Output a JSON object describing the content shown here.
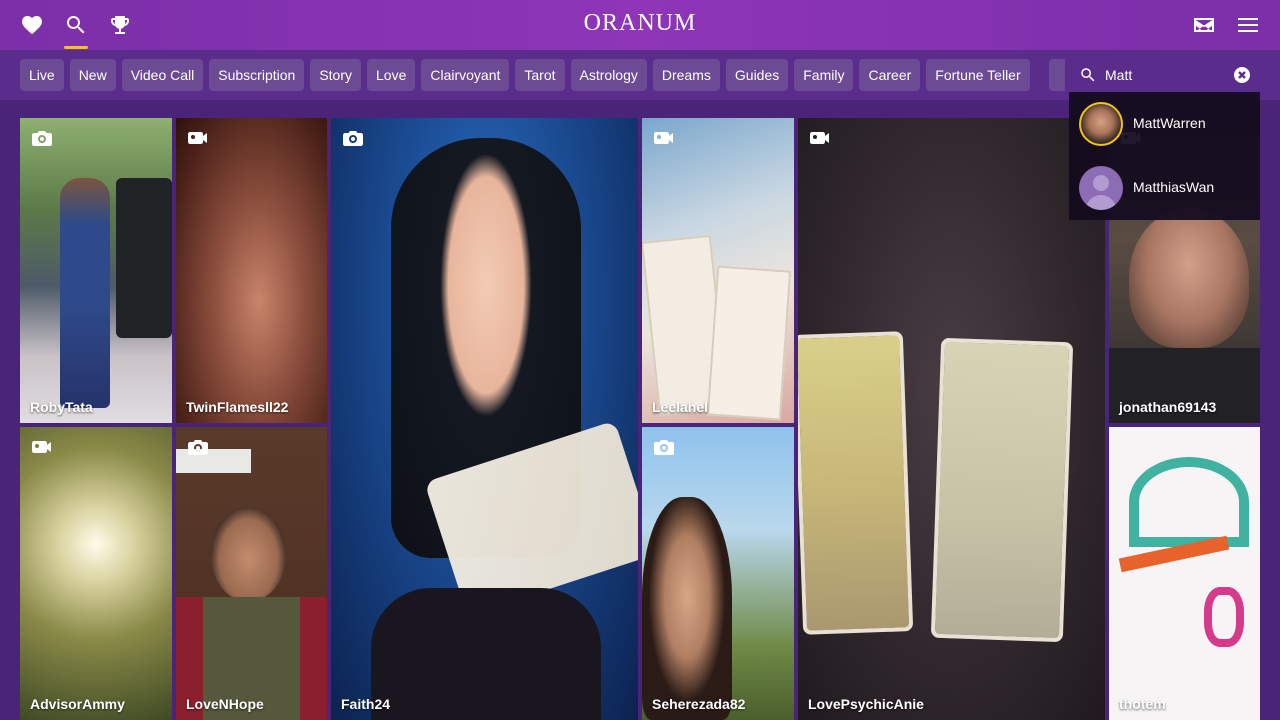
{
  "header": {
    "logo": "Oranum",
    "icons": [
      "heart-icon",
      "search-icon",
      "trophy-icon",
      "mail-icon",
      "menu-icon"
    ],
    "accent_color": "#f0c419"
  },
  "filters": {
    "chips": [
      "Live",
      "New",
      "Video Call",
      "Subscription",
      "Story",
      "Love",
      "Clairvoyant",
      "Tarot",
      "Astrology",
      "Dreams",
      "Guides",
      "Family",
      "Career",
      "Fortune Teller"
    ]
  },
  "search": {
    "value": "Matt",
    "suggestions": [
      {
        "name": "MattWarren"
      },
      {
        "name": "MatthiasWan"
      }
    ]
  },
  "tiles": [
    {
      "name": "RobyTata",
      "media": "camera-icon"
    },
    {
      "name": "TwinFlamesll22",
      "media": "video-icon"
    },
    {
      "name": "Faith24",
      "media": "camera-icon"
    },
    {
      "name": "Leelahel",
      "media": "video-icon"
    },
    {
      "name": "LovePsychicAnie",
      "media": "video-icon"
    },
    {
      "name": "jonathan69143",
      "media": "video-icon"
    },
    {
      "name": "AdvisorAmmy",
      "media": "video-icon"
    },
    {
      "name": "LoveNHope",
      "media": "camera-icon"
    },
    {
      "name": "Seherezada82",
      "media": "camera-icon"
    },
    {
      "name": "thotem",
      "media": "none"
    }
  ]
}
